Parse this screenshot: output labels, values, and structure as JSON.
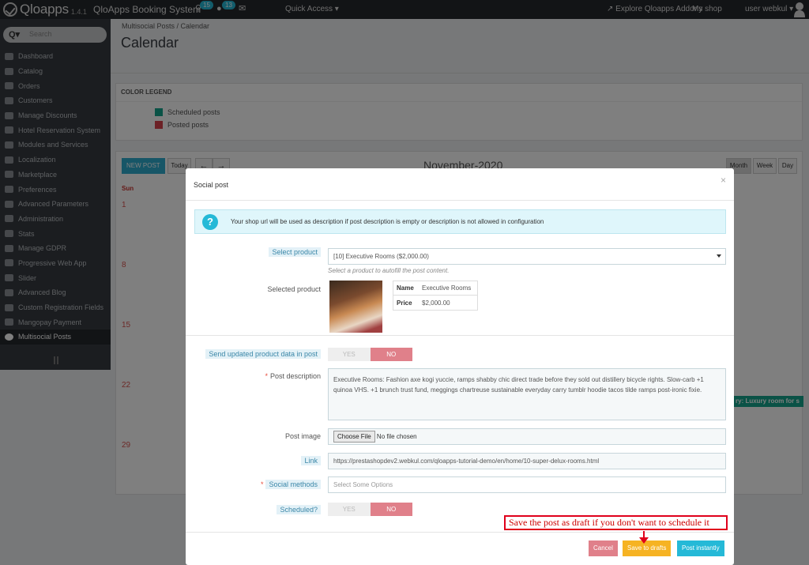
{
  "topbar": {
    "logo": "Qloapps",
    "version": "1.4.1",
    "shop_name": "QloApps Booking System",
    "cart_badge": "15",
    "user_badge": "13",
    "quick_access": "Quick Access ▾",
    "explore": "↗ Explore Qloapps Addons",
    "my_shop": "My shop",
    "user": "user webkul ▾"
  },
  "sidebar": {
    "search_placeholder": "Search",
    "items": [
      {
        "label": "Dashboard",
        "icon": "dashboard-icon"
      },
      {
        "label": "Catalog",
        "icon": "book-icon"
      },
      {
        "label": "Orders",
        "icon": "credit-card-icon"
      },
      {
        "label": "Customers",
        "icon": "users-icon"
      },
      {
        "label": "Manage Discounts",
        "icon": "tag-icon"
      },
      {
        "label": "Hotel Reservation System",
        "icon": "bed-icon"
      },
      {
        "label": "Modules and Services",
        "icon": "puzzle-icon"
      },
      {
        "label": "Localization",
        "icon": "globe-icon"
      },
      {
        "label": "Marketplace",
        "icon": "cart-icon"
      },
      {
        "label": "Preferences",
        "icon": "wrench-icon"
      },
      {
        "label": "Advanced Parameters",
        "icon": "cogs-icon"
      },
      {
        "label": "Administration",
        "icon": "cog-icon"
      },
      {
        "label": "Stats",
        "icon": "bar-chart-icon"
      },
      {
        "label": "Manage GDPR",
        "icon": "gavel-icon"
      },
      {
        "label": "Progressive Web App",
        "icon": "bolt-icon"
      },
      {
        "label": "Slider",
        "icon": "slider-icon"
      },
      {
        "label": "Advanced Blog",
        "icon": "bookmark-icon"
      },
      {
        "label": "Custom Registration Fields",
        "icon": "file-icon"
      },
      {
        "label": "Mangopay Payment",
        "icon": "money-icon"
      },
      {
        "label": "Multisocial Posts",
        "icon": "globe-icon"
      }
    ]
  },
  "page": {
    "breadcrumb": "Multisocial Posts  /  Calendar",
    "title": "Calendar"
  },
  "legend": {
    "title": "COLOR LEGEND",
    "scheduled": "Scheduled posts",
    "posted": "Posted posts",
    "scheduled_color": "#14a58c",
    "posted_color": "#d9434d"
  },
  "calendar": {
    "new_post": "NEW POST",
    "today": "Today",
    "prev": "←",
    "next": "→",
    "month": "November-2020",
    "view_month": "Month",
    "view_week": "Week",
    "view_day": "Day",
    "sun": "Sun",
    "days": [
      "1",
      "8",
      "15",
      "22",
      "29"
    ],
    "event": "ry: Luxury room for s"
  },
  "modal": {
    "title": "Social post",
    "close": "×",
    "info": "Your shop url will be used as description if post description is empty or description is not allowed in configuration",
    "select_product_label": "Select product",
    "select_product_value": "[10] Executive Rooms ($2,000.00)",
    "select_help": "Select a product to autofill the post content.",
    "selected_product_label": "Selected product",
    "name_label": "Name",
    "name_value": "Executive Rooms",
    "price_label": "Price",
    "price_value": "$2,000.00",
    "send_updated_label": "Send updated product data in post",
    "yes": "YES",
    "no": "NO",
    "description_label": "Post description",
    "description": "Executive Rooms: Fashion axe kogi yuccie, ramps shabby chic direct trade before they sold out distillery bicycle rights. Slow-carb +1 quinoa VHS. +1 brunch trust fund, meggings chartreuse sustainable everyday carry tumblr hoodie tacos tilde ramps post-ironic fixie.",
    "image_label": "Post image",
    "choose_file": "Choose File",
    "no_file": "No file chosen",
    "link_label": "Link",
    "link_value": "https://prestashopdev2.webkul.com/qloapps-tutorial-demo/en/home/10-super-delux-rooms.html",
    "social_label": "Social methods",
    "social_placeholder": "Select Some Options",
    "scheduled_label": "Scheduled?",
    "cancel": "Cancel",
    "save_drafts": "Save to drafts",
    "post_instantly": "Post instantly"
  },
  "annotation": "Save the post as draft if you don't want to schedule it"
}
